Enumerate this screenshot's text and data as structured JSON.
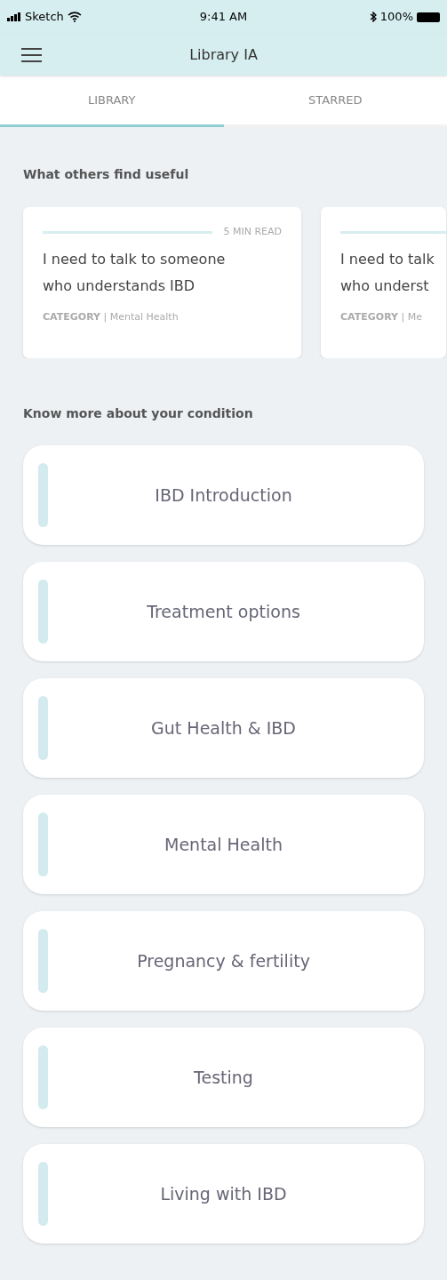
{
  "status_bar": {
    "carrier": "Sketch",
    "time": "9:41 AM",
    "battery": "100%"
  },
  "nav": {
    "title": "Library IA"
  },
  "tabs": [
    {
      "label": "LIBRARY",
      "selected": true
    },
    {
      "label": "STARRED",
      "selected": false
    }
  ],
  "useful": {
    "heading": "What others find useful",
    "cards": [
      {
        "read_time": "5 MIN READ",
        "title_lines": [
          "I need to talk to someone",
          "who understands IBD"
        ],
        "category": "**CATEGORY** | Mental Health"
      },
      {
        "title_lines": [
          "I need to talk",
          "who underst"
        ],
        "category": "**CATEGORY** | Me"
      }
    ]
  },
  "condition": {
    "heading": "Know more about your condition",
    "topics": [
      "IBD Introduction",
      "Treatment options",
      "Gut Health & IBD",
      "Mental Health",
      "Pregnancy & fertility",
      "Testing",
      "Living with IBD"
    ]
  }
}
